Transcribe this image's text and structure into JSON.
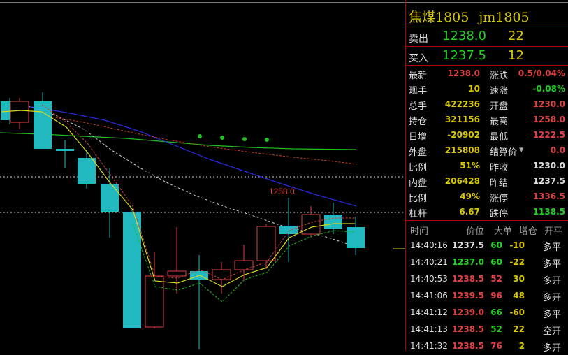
{
  "header": {
    "name": "焦煤1805",
    "code": "jm1805"
  },
  "quote": {
    "sell": {
      "label": "卖出",
      "price": "1238.0",
      "vol": "22"
    },
    "buy": {
      "label": "买入",
      "price": "1237.5",
      "vol": "12"
    }
  },
  "stats_left": [
    {
      "label": "最新",
      "value": "1238.0",
      "color": "#e04040"
    },
    {
      "label": "现手",
      "value": "10",
      "color": "#d8c800"
    },
    {
      "label": "总手",
      "value": "422236",
      "color": "#d8c800"
    },
    {
      "label": "持仓",
      "value": "321156",
      "color": "#d8c800"
    },
    {
      "label": "日增",
      "value": "-20902",
      "color": "#d8c800"
    },
    {
      "label": "外盘",
      "value": "215808",
      "color": "#d8c800"
    },
    {
      "label": "比例",
      "value": "51%",
      "color": "#d8c800"
    },
    {
      "label": "内盘",
      "value": "206428",
      "color": "#d8c800"
    },
    {
      "label": "比例",
      "value": "49%",
      "color": "#d8c800"
    },
    {
      "label": "杠杆",
      "value": "6.67",
      "color": "#d8c800"
    }
  ],
  "stats_right": [
    {
      "label": "涨跌",
      "value": "0.5/0.04%",
      "color": "#e04040"
    },
    {
      "label": "速涨",
      "value": "-0.08%",
      "color": "#22d022"
    },
    {
      "label": "开盘",
      "value": "1230.0",
      "color": "#e04040"
    },
    {
      "label": "最高",
      "value": "1258.0",
      "color": "#e04040"
    },
    {
      "label": "最低",
      "value": "1222.5",
      "color": "#e04040"
    },
    {
      "label": "结算价",
      "value": "0.0",
      "color": "#e04040"
    },
    {
      "label": "昨收",
      "value": "1230.0",
      "color": "#dddddd"
    },
    {
      "label": "昨结",
      "value": "1237.5",
      "color": "#dddddd"
    },
    {
      "label": "涨停",
      "value": "1336.5",
      "color": "#e04040"
    },
    {
      "label": "跌停",
      "value": "1138.5",
      "color": "#22d022"
    }
  ],
  "ticks_header": {
    "time": "时间",
    "price": "价位",
    "big": "大单",
    "chg": "增仓",
    "open": "开平"
  },
  "ticks": [
    {
      "time": "14:40:16",
      "price": "1237.5",
      "big": "60",
      "chg": "-10",
      "dir": "多平",
      "pc": "#dddddd",
      "bc": "#22d022",
      "cc": "#d8c800"
    },
    {
      "time": "14:40:21",
      "price": "1237.0",
      "big": "60",
      "chg": "-22",
      "dir": "多平",
      "pc": "#22d022",
      "bc": "#22d022",
      "cc": "#d8c800"
    },
    {
      "time": "14:40:53",
      "price": "1238.5",
      "big": "52",
      "chg": "30",
      "dir": "多开",
      "pc": "#e04040",
      "bc": "#e04040",
      "cc": "#d8c800"
    },
    {
      "time": "14:41:06",
      "price": "1239.5",
      "big": "96",
      "chg": "48",
      "dir": "多开",
      "pc": "#e04040",
      "bc": "#e04040",
      "cc": "#d8c800"
    },
    {
      "time": "14:41:12",
      "price": "1239.0",
      "big": "66",
      "chg": "-60",
      "dir": "多平",
      "pc": "#e04040",
      "bc": "#22d022",
      "cc": "#d8c800"
    },
    {
      "time": "14:41:13",
      "price": "1238.5",
      "big": "52",
      "chg": "22",
      "dir": "空开",
      "pc": "#e04040",
      "bc": "#22d022",
      "cc": "#d8c800"
    },
    {
      "time": "14:41:32",
      "price": "1238.5",
      "big": "76",
      "chg": "2",
      "dir": "多开",
      "pc": "#e04040",
      "bc": "#e04040",
      "cc": "#d8c800"
    }
  ],
  "chart": {
    "high_label": "1258.0",
    "colors": {
      "up": "#e04040",
      "down": "#22b8c0",
      "ma_yellow": "#d8d820",
      "ma_blue": "#2020d0",
      "ma_green": "#20c020",
      "ma_red": "#c04020"
    }
  }
}
